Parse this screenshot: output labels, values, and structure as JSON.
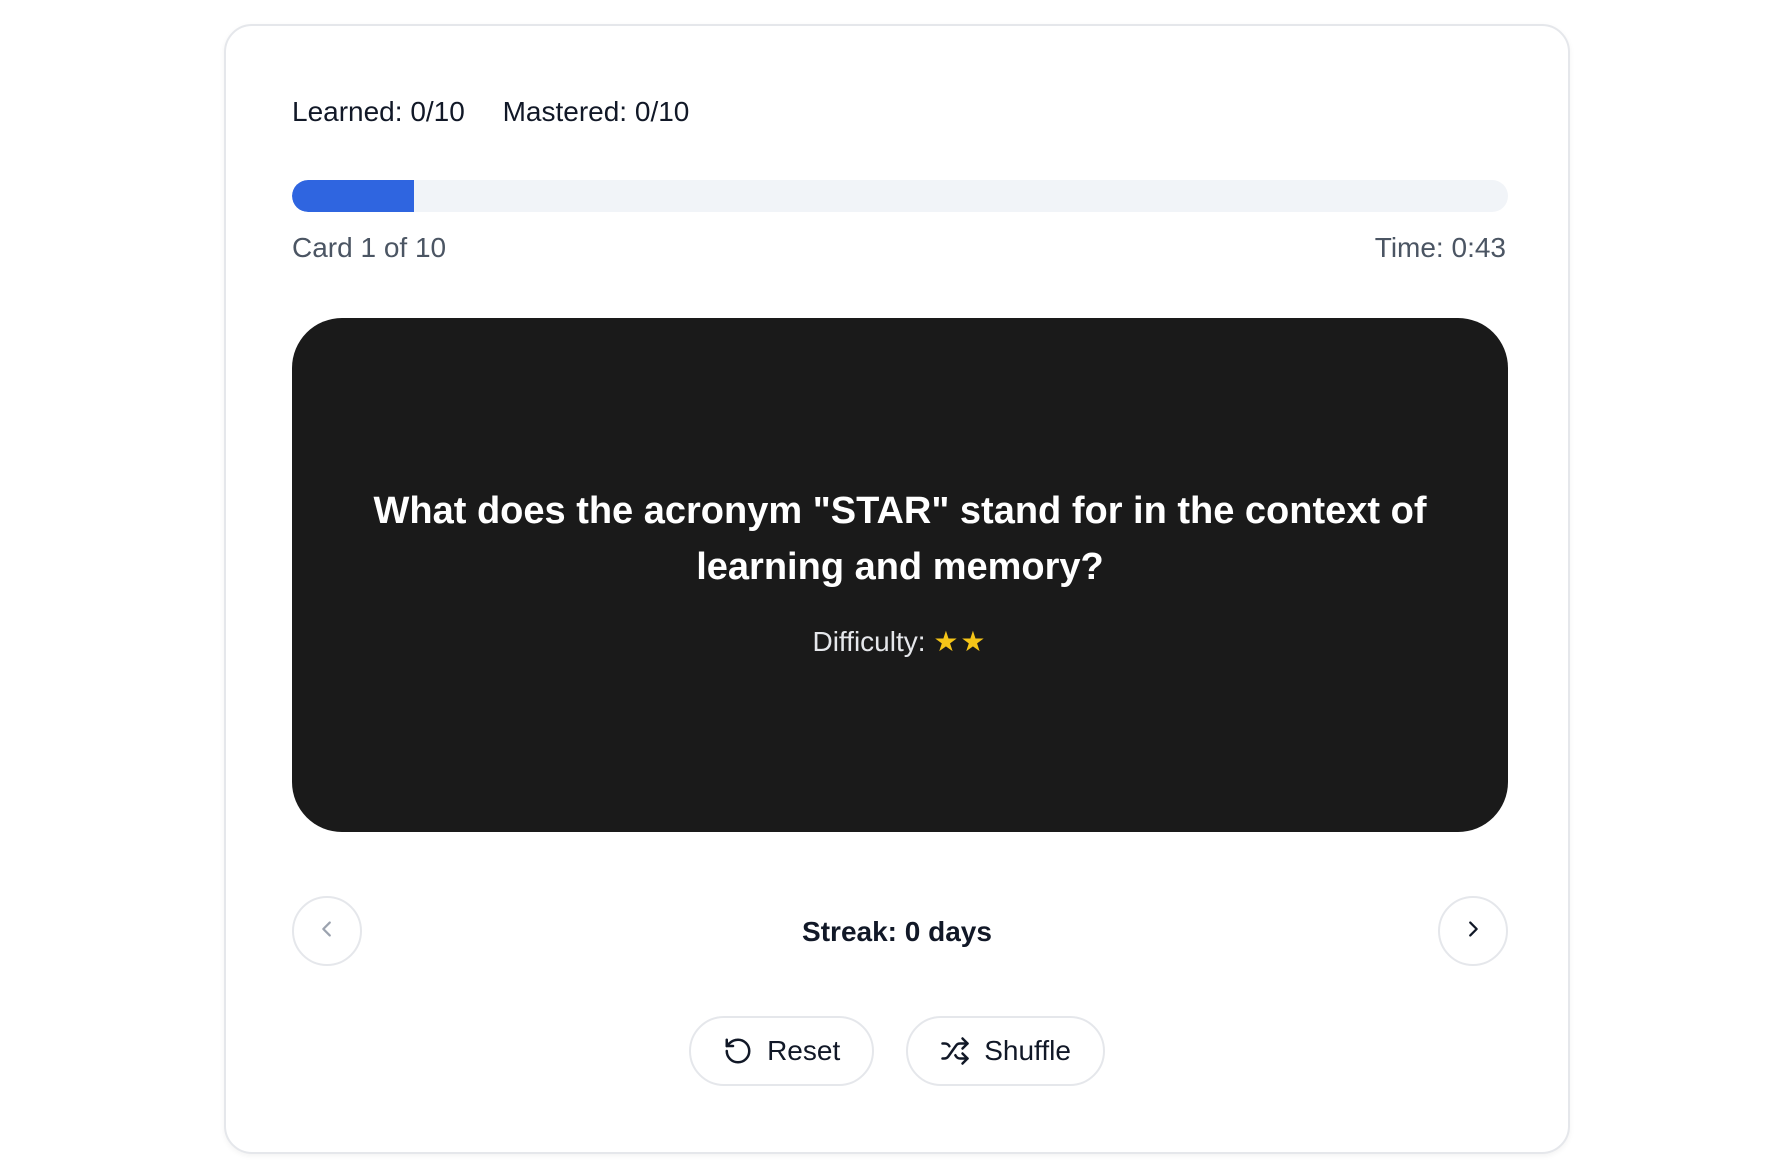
{
  "stats": {
    "learned": "Learned: 0/10",
    "mastered": "Mastered: 0/10"
  },
  "progress": {
    "fraction": 0.1,
    "accent_color": "#2f65e0",
    "card_label": "Card 1 of 10",
    "time_label": "Time: 0:43"
  },
  "card": {
    "question": "What does the acronym \"STAR\" stand for in the context of learning and memory?",
    "difficulty_label": "Difficulty:",
    "difficulty_stars": "★★",
    "difficulty_level": 2
  },
  "navigation": {
    "prev_icon": "chevron-left-icon",
    "next_icon": "chevron-right-icon",
    "streak": "Streak: 0 days"
  },
  "actions": {
    "reset_label": "Reset",
    "reset_icon": "rotate-ccw-icon",
    "shuffle_label": "Shuffle",
    "shuffle_icon": "shuffle-icon"
  }
}
